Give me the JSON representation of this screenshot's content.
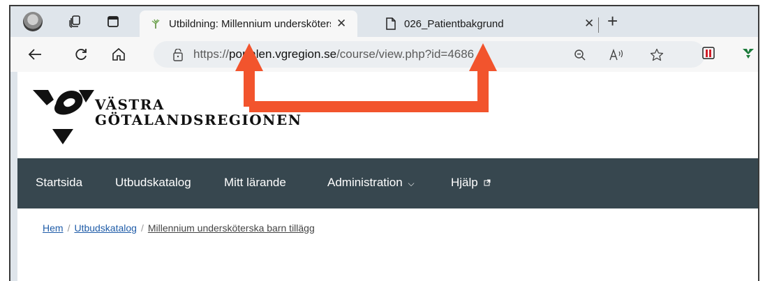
{
  "browser": {
    "tabs": [
      {
        "title": "Utbildning: Millennium undersköterska barn tillägg",
        "active": true
      },
      {
        "title": "026_Patientbakgrund",
        "active": false
      }
    ],
    "address": {
      "prefix": "https://",
      "host": "portalen.vgregion.se",
      "path": "/course/view.php?id=4686"
    },
    "accent_annotation": "#f2542d"
  },
  "site": {
    "logo_line1": "VÄSTRA",
    "logo_line2": "GÖTALANDSREGIONEN",
    "nav": [
      {
        "label": "Startsida"
      },
      {
        "label": "Utbudskatalog"
      },
      {
        "label": "Mitt lärande"
      },
      {
        "label": "Administration"
      },
      {
        "label": "Hjälp"
      }
    ],
    "nav_bg": "#37474f",
    "breadcrumb": [
      {
        "label": "Hem"
      },
      {
        "label": "Utbudskatalog"
      },
      {
        "label": "Millennium undersköterska barn tillägg"
      }
    ]
  }
}
